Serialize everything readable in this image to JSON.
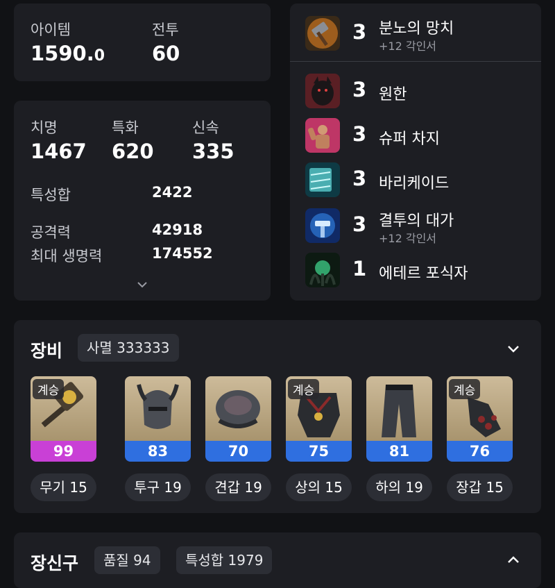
{
  "summary": {
    "item_label": "아이템",
    "item_value_main": "1590.",
    "item_value_dec": "0",
    "combat_label": "전투",
    "combat_value": "60"
  },
  "stats": {
    "crit_label": "치명",
    "crit_value": "1467",
    "spec_label": "특화",
    "spec_value": "620",
    "swift_label": "신속",
    "swift_value": "335",
    "total_label": "특성합",
    "total_value": "2422",
    "attack_label": "공격력",
    "attack_value": "42918",
    "hp_label": "최대 생명력",
    "hp_value": "174552"
  },
  "engravings": [
    {
      "level": "3",
      "name": "분노의 망치",
      "sub": "+12 각인서",
      "icon": "hammer-icon"
    },
    {
      "level": "3",
      "name": "원한",
      "sub": "",
      "icon": "grudge-icon"
    },
    {
      "level": "3",
      "name": "슈퍼 차지",
      "sub": "",
      "icon": "super-charge-icon"
    },
    {
      "level": "3",
      "name": "바리케이드",
      "sub": "",
      "icon": "barricade-icon"
    },
    {
      "level": "3",
      "name": "결투의 대가",
      "sub": "+12 각인서",
      "icon": "duel-master-icon"
    },
    {
      "level": "1",
      "name": "에테르 포식자",
      "sub": "",
      "icon": "ether-predator-icon"
    }
  ],
  "equipment": {
    "title": "장비",
    "set_badge": "사멸 333333",
    "items": [
      {
        "quality": "99",
        "tag": "계승",
        "slot": "무기 15",
        "bar_color": "#c940d6",
        "icon": "weapon-icon"
      },
      {
        "quality": "83",
        "tag": "",
        "slot": "투구 19",
        "bar_color": "#2f6fe0",
        "icon": "helmet-icon"
      },
      {
        "quality": "70",
        "tag": "",
        "slot": "견갑 19",
        "bar_color": "#2f6fe0",
        "icon": "shoulder-icon"
      },
      {
        "quality": "75",
        "tag": "계승",
        "slot": "상의 15",
        "bar_color": "#2f6fe0",
        "icon": "chest-icon"
      },
      {
        "quality": "81",
        "tag": "",
        "slot": "하의 19",
        "bar_color": "#2f6fe0",
        "icon": "pants-icon"
      },
      {
        "quality": "76",
        "tag": "계승",
        "slot": "장갑 15",
        "bar_color": "#2f6fe0",
        "icon": "gloves-icon"
      }
    ]
  },
  "accessories": {
    "title": "장신구",
    "quality_badge": "품질 94",
    "stat_badge": "특성합 1979"
  }
}
